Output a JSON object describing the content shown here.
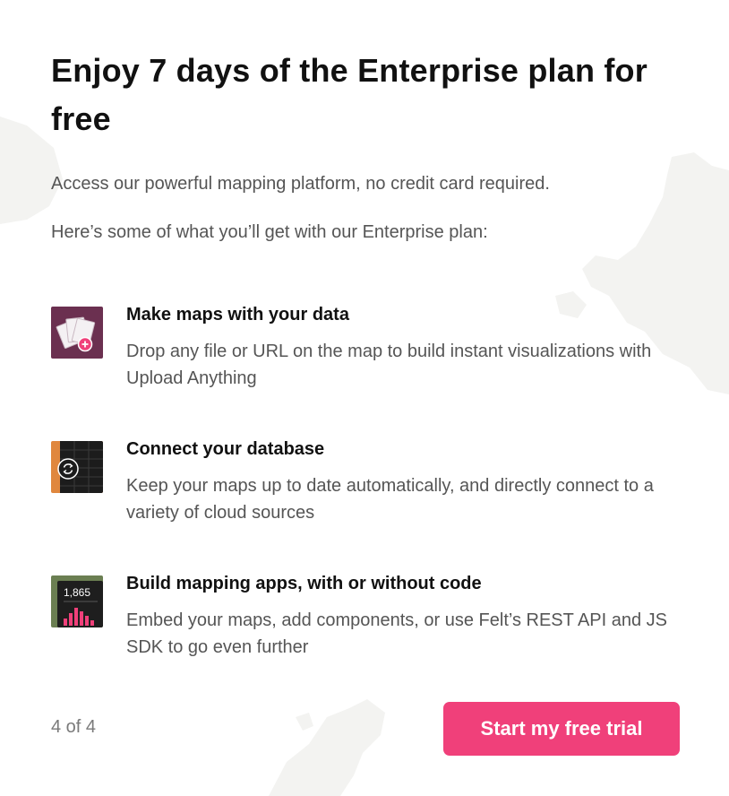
{
  "dialog": {
    "title": "Enjoy 7 days of the Enterprise plan for free",
    "intro_1": "Access our powerful mapping platform, no credit card required.",
    "intro_2": "Here’s some of what you’ll get with our Enterprise plan:"
  },
  "features": [
    {
      "icon": "upload-files-icon",
      "title": "Make maps with your data",
      "description": "Drop any file or URL on the map to build instant visualizations with Upload Anything"
    },
    {
      "icon": "database-sync-icon",
      "title": "Connect your database",
      "description": "Keep your maps up to date automatically, and directly connect to a variety of cloud sources"
    },
    {
      "icon": "app-chart-icon",
      "title": "Build mapping apps, with or without code",
      "description": "Embed your maps, add components, or use Felt’s REST API and JS SDK to go even further",
      "thumb_value": "1,865"
    }
  ],
  "footer": {
    "pager": "4 of 4",
    "cta_label": "Start my free trial"
  },
  "colors": {
    "accent": "#f0407a",
    "thumb_1_bg": "#6b3050",
    "thumb_2_bg": "#e0873e",
    "thumb_3_bg": "#6b7f52"
  }
}
